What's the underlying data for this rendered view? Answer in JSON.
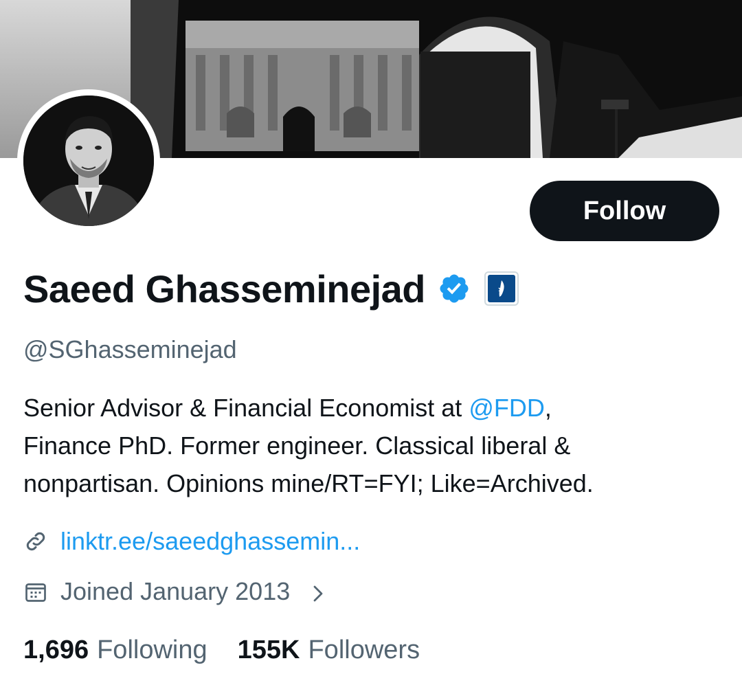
{
  "profile": {
    "display_name": "Saeed Ghasseminejad",
    "handle": "@SGhasseminejad",
    "bio_prefix": "Senior Advisor & Financial Economist at ",
    "bio_mention": "@FDD",
    "bio_rest_line1": ",",
    "bio_line2": "Finance PhD. Former engineer. Classical liberal &",
    "bio_line3": "nonpartisan. Opinions mine/RT=FYI; Like=Archived.",
    "website": "linktr.ee/saeedghassemin...",
    "joined": "Joined January 2013",
    "verified": true,
    "affiliate_badge": true
  },
  "actions": {
    "follow_label": "Follow"
  },
  "stats": {
    "following_count": "1,696",
    "following_label": "Following",
    "followers_count": "155K",
    "followers_label": "Followers"
  },
  "icons": {
    "verified": "verified-badge-icon",
    "affiliate": "organization-affiliate-icon",
    "link": "link-icon",
    "calendar": "calendar-icon",
    "chevron": "chevron-right-icon"
  },
  "colors": {
    "accent": "#1d9bf0",
    "text": "#0f1419",
    "secondary_text": "#536471",
    "follow_bg": "#0f1419",
    "follow_text": "#ffffff"
  }
}
